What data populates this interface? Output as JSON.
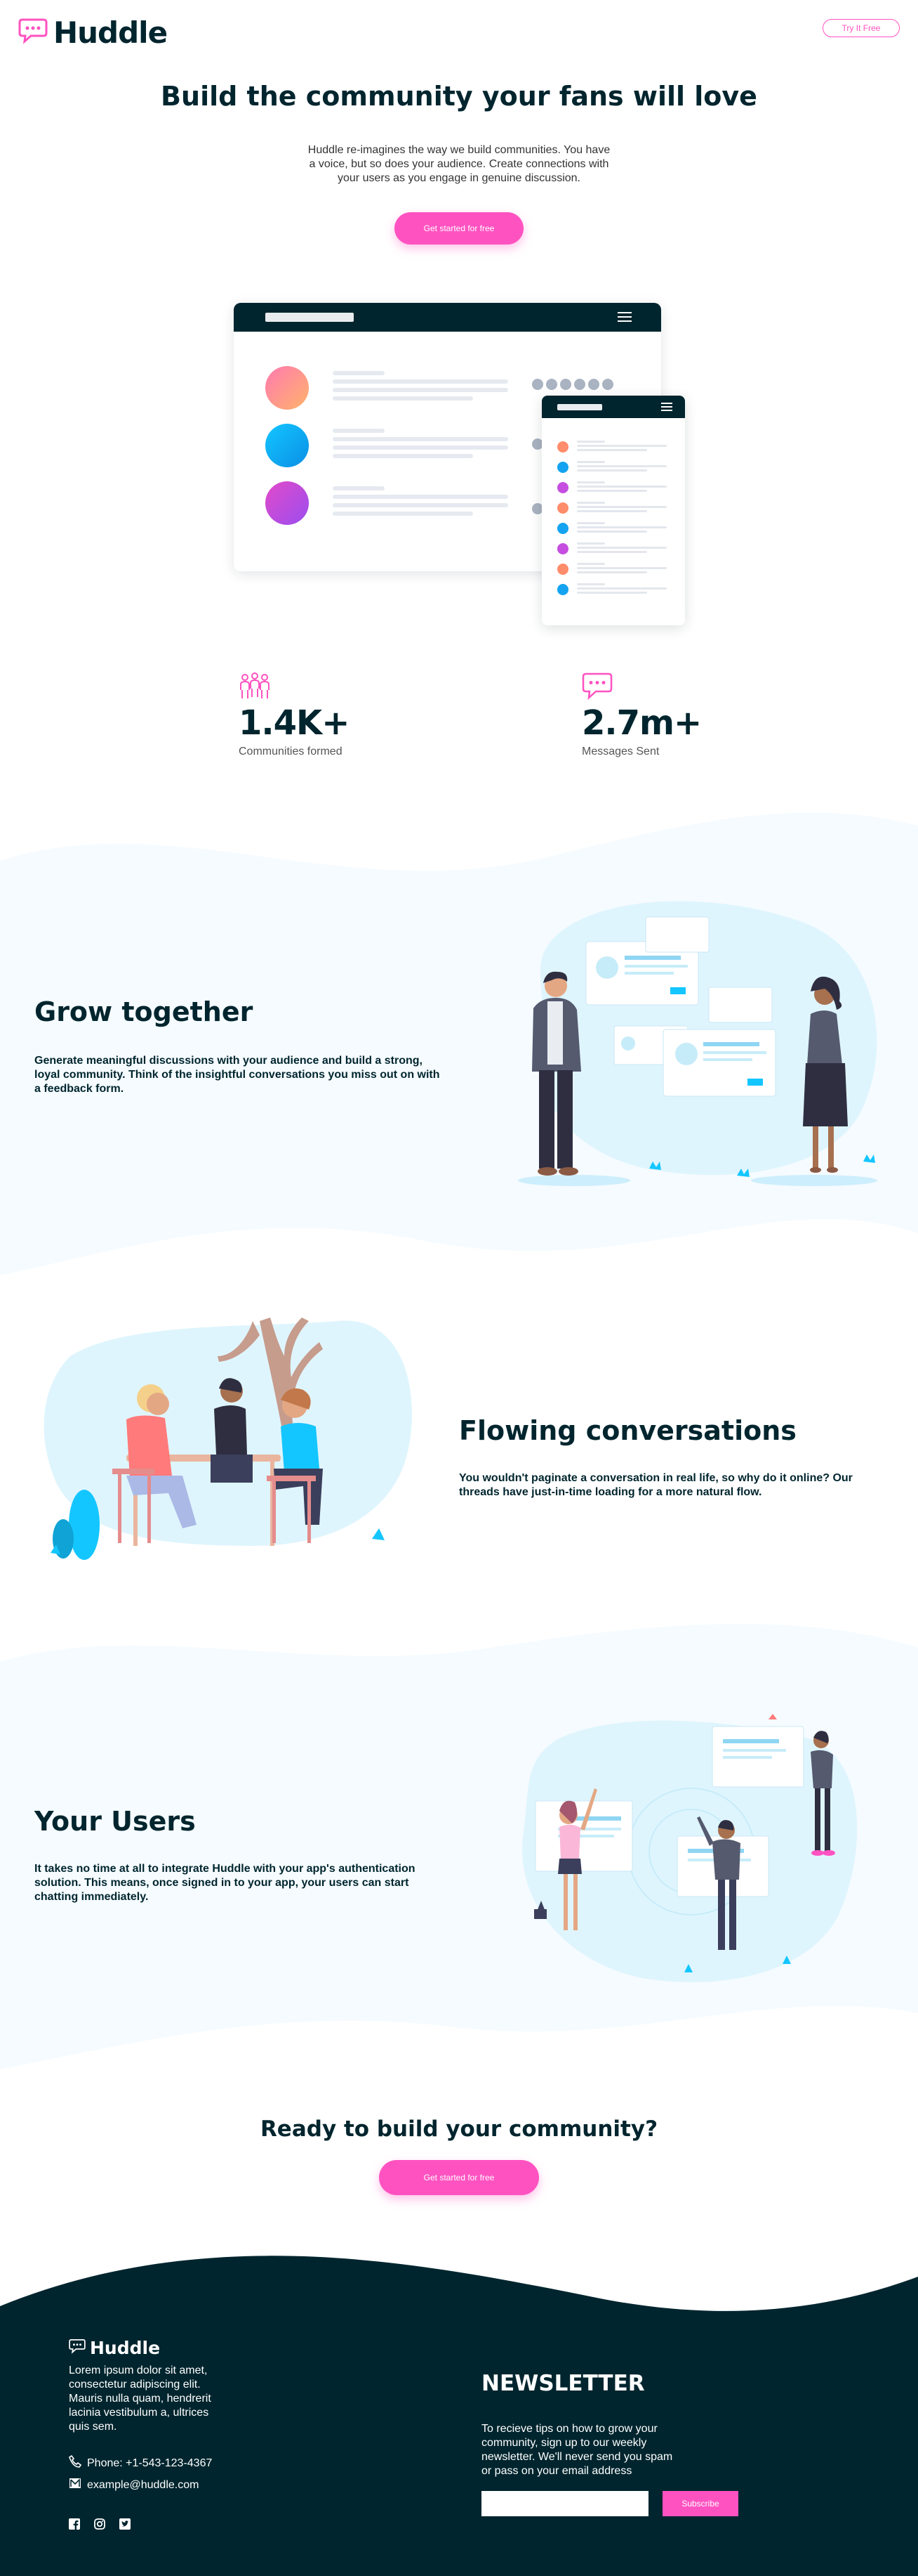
{
  "brand": {
    "name": "Huddle",
    "accent": "#ff52c1",
    "dark": "#00252e",
    "light_bg": "#f5fbff"
  },
  "header": {
    "logo_icon": "chat-bubble-icon",
    "cta_label": "Try It Free"
  },
  "hero": {
    "title": "Build the community your fans will love",
    "subtitle": "Huddle re-imagines the way we build communities. You have a voice, but so does your audience. Create connections with your users as you engage in genuine discussion.",
    "cta_label": "Get started for free"
  },
  "stats": [
    {
      "icon": "communities-icon",
      "value": "1.4K+",
      "label": "Communities formed"
    },
    {
      "icon": "messages-icon",
      "value": "2.7m+",
      "label": "Messages Sent"
    }
  ],
  "features": [
    {
      "title": "Grow together",
      "body": "Generate meaningful discussions with your audience and build a strong, loyal community. Think of the insightful conversations you miss out on with a feedback form."
    },
    {
      "title": "Flowing conversations",
      "body": "You wouldn't paginate a conversation in real life, so why do it online? Our threads have just-in-time loading for a more natural flow."
    },
    {
      "title": "Your Users",
      "body": "It takes no time at all to integrate Huddle with your app's authentication solution. This means, once signed in to your app, your users can start chatting immediately."
    }
  ],
  "ready": {
    "title": "Ready to build your community?",
    "cta_label": "Get started for free"
  },
  "footer": {
    "description": "Lorem ipsum dolor sit amet, consectetur adipiscing elit. Mauris nulla quam, hendrerit lacinia vestibulum a, ultrices quis sem.",
    "phone": "Phone: +1-543-123-4367",
    "email": "example@huddle.com",
    "social": [
      "facebook-icon",
      "instagram-icon",
      "twitter-icon"
    ],
    "newsletter": {
      "title": "NEWSLETTER",
      "text": "To recieve tips on how to grow your community, sign up to our weekly newsletter. We'll never send you spam or pass on your email address",
      "input_value": "",
      "button_label": "Subscribe"
    }
  }
}
